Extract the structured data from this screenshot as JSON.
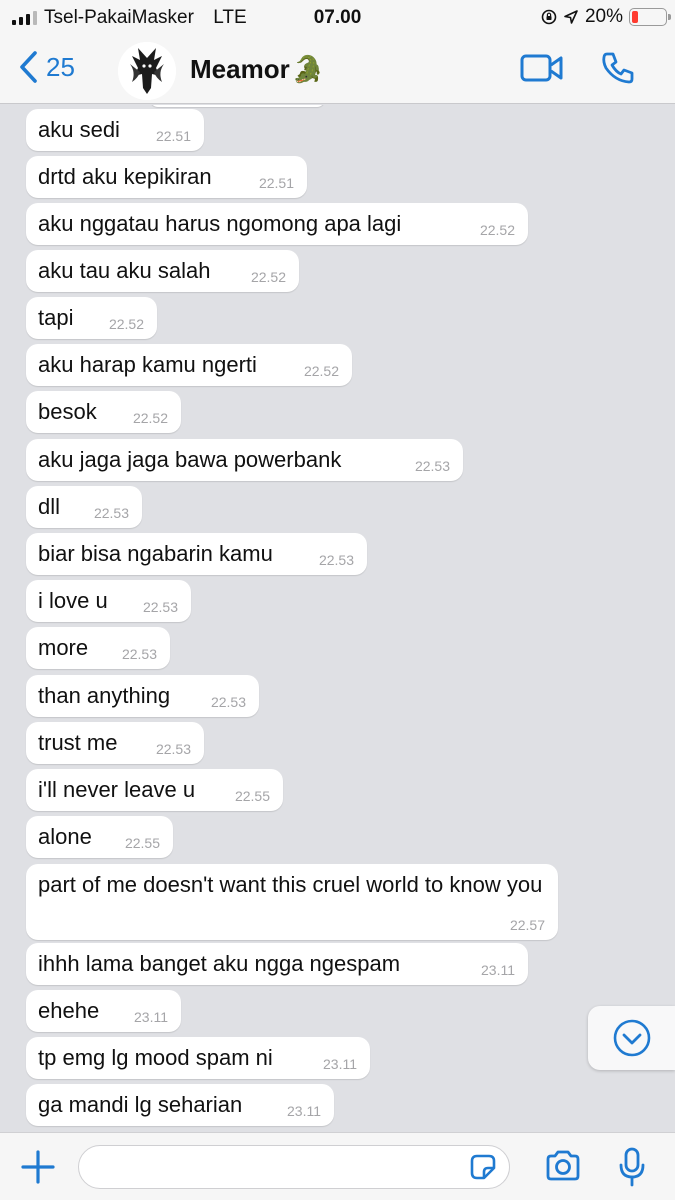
{
  "status_bar": {
    "carrier": "Tsel-PakaiMasker",
    "network": "LTE",
    "time": "07.00",
    "battery_percent": "20%",
    "battery_level": 0.2,
    "battery_color": "#ff3b30"
  },
  "header": {
    "back_count": "25",
    "contact_name": "Meamor",
    "contact_emoji": "🐊",
    "accent_color": "#1f7ad1",
    "icons": [
      "chevron-left-icon",
      "video-camera-icon",
      "phone-icon"
    ]
  },
  "messages": [
    {
      "text": "aku sedi",
      "time": "22.51"
    },
    {
      "text": "drtd aku kepikiran",
      "time": "22.51"
    },
    {
      "text": "aku nggatau harus ngomong apa lagi",
      "time": "22.52"
    },
    {
      "text": "aku tau aku salah",
      "time": "22.52"
    },
    {
      "text": "tapi",
      "time": "22.52"
    },
    {
      "text": "aku harap kamu ngerti",
      "time": "22.52"
    },
    {
      "text": "besok",
      "time": "22.52"
    },
    {
      "text": "aku jaga jaga bawa powerbank",
      "time": "22.53"
    },
    {
      "text": "dll",
      "time": "22.53"
    },
    {
      "text": "biar bisa ngabarin kamu",
      "time": "22.53"
    },
    {
      "text": "i love u",
      "time": "22.53"
    },
    {
      "text": "more",
      "time": "22.53"
    },
    {
      "text": "than anything",
      "time": "22.53"
    },
    {
      "text": "trust me",
      "time": "22.53"
    },
    {
      "text": "i'll never leave u",
      "time": "22.55"
    },
    {
      "text": "alone",
      "time": "22.55"
    },
    {
      "text": "part of me doesn't want this cruel world to know you",
      "time": "22.57"
    },
    {
      "text": "ihhh lama banget aku ngga ngespam",
      "time": "23.11"
    },
    {
      "text": "ehehe",
      "time": "23.11"
    },
    {
      "text": "tp emg lg mood spam ni",
      "time": "23.11"
    },
    {
      "text": "ga mandi lg seharian",
      "time": "23.11"
    }
  ],
  "input_bar": {
    "placeholder": "",
    "icons": [
      "plus-icon",
      "sticker-icon",
      "camera-icon",
      "microphone-icon"
    ]
  },
  "scroll_down_icon": "chevron-down-circle-icon"
}
